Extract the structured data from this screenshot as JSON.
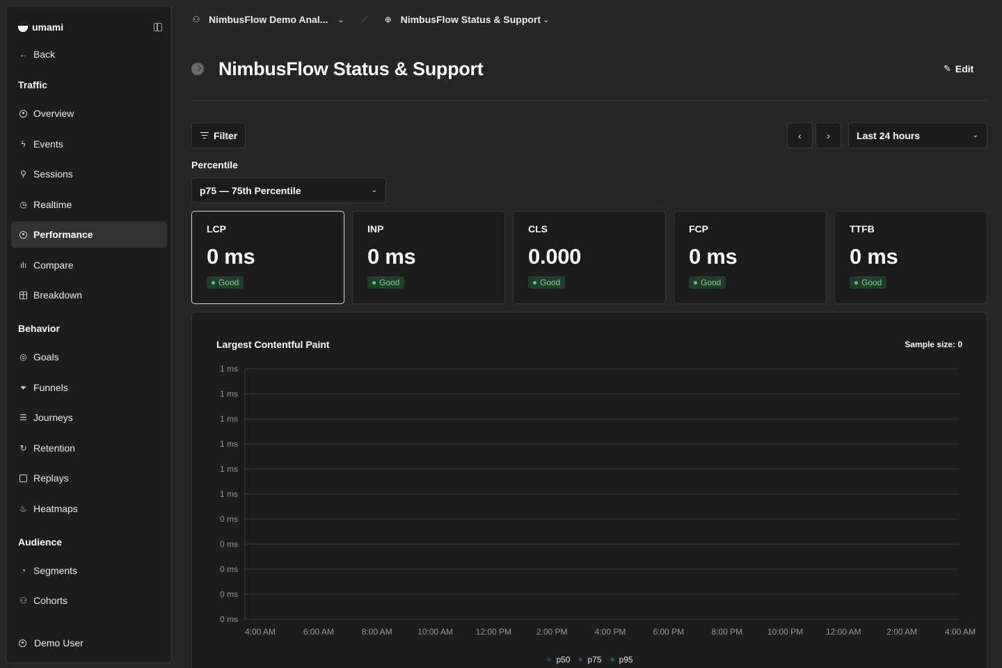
{
  "sidebar": {
    "brand": "umami",
    "back": "Back",
    "sections": {
      "traffic": "Traffic",
      "behavior": "Behavior",
      "audience": "Audience"
    },
    "items": {
      "overview": "Overview",
      "events": "Events",
      "sessions": "Sessions",
      "realtime": "Realtime",
      "performance": "Performance",
      "compare": "Compare",
      "breakdown": "Breakdown",
      "goals": "Goals",
      "funnels": "Funnels",
      "journeys": "Journeys",
      "retention": "Retention",
      "replays": "Replays",
      "heatmaps": "Heatmaps",
      "segments": "Segments",
      "cohorts": "Cohorts"
    },
    "active_item": "Performance",
    "user": "Demo User"
  },
  "breadcrumb": {
    "team": "NimbusFlow Demo Anal...",
    "website": "NimbusFlow Status & Support"
  },
  "header": {
    "title": "NimbusFlow Status & Support",
    "edit_label": "Edit"
  },
  "toolbar": {
    "filter_label": "Filter",
    "date_range": "Last 24 hours"
  },
  "percentile": {
    "label": "Percentile",
    "selected": "p75 — 75th Percentile"
  },
  "metrics": [
    {
      "name": "LCP",
      "value": "0 ms",
      "status": "Good"
    },
    {
      "name": "INP",
      "value": "0 ms",
      "status": "Good"
    },
    {
      "name": "CLS",
      "value": "0.000",
      "status": "Good"
    },
    {
      "name": "FCP",
      "value": "0 ms",
      "status": "Good"
    },
    {
      "name": "TTFB",
      "value": "0 ms",
      "status": "Good"
    }
  ],
  "selected_metric": "LCP",
  "colors": {
    "good_badge_bg": "#1f3d2a",
    "good_badge_text": "#7fd694",
    "p50": "#2a3a5a",
    "p75": "#3a3f5e",
    "p95": "#2f5a3b"
  },
  "chart_data": {
    "type": "line",
    "title": "Largest Contentful Paint",
    "sample_size_label": "Sample size: 0",
    "y_tick_labels": [
      "1 ms",
      "1 ms",
      "1 ms",
      "1 ms",
      "1 ms",
      "1 ms",
      "0 ms",
      "0 ms",
      "0 ms",
      "0 ms",
      "0 ms"
    ],
    "x": [
      "4:00 AM",
      "6:00 AM",
      "8:00 AM",
      "10:00 AM",
      "12:00 PM",
      "2:00 PM",
      "4:00 PM",
      "6:00 PM",
      "8:00 PM",
      "10:00 PM",
      "12:00 AM",
      "2:00 AM",
      "4:00 AM"
    ],
    "series": [
      {
        "name": "p50",
        "values": []
      },
      {
        "name": "p75",
        "values": []
      },
      {
        "name": "p95",
        "values": []
      }
    ],
    "grid": true,
    "legend": "bottom"
  }
}
